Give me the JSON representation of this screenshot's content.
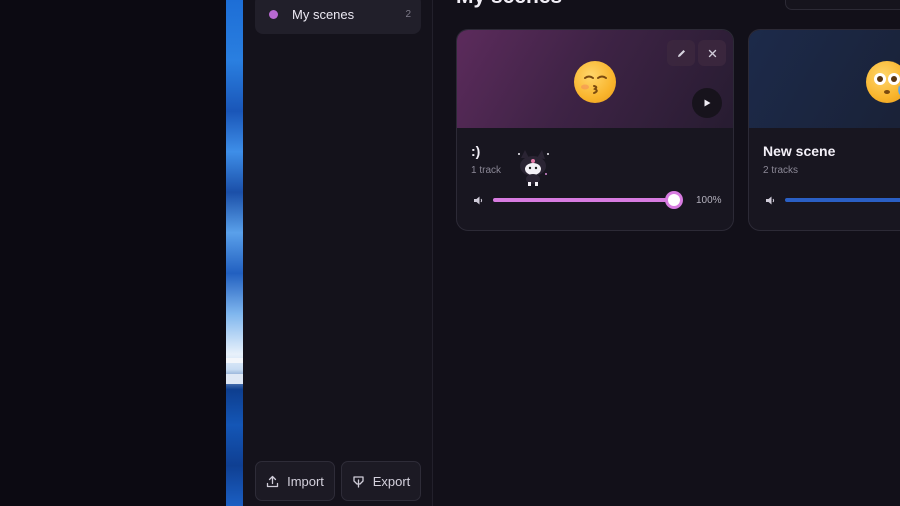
{
  "sidebar": {
    "nav_item": {
      "label": "My scenes",
      "count": "2",
      "dot_color": "#b869d2"
    },
    "import_label": "Import",
    "export_label": "Export"
  },
  "main": {
    "title": "My scenes",
    "scenes": [
      {
        "name": ":)",
        "tracks": "1 track",
        "volume_percent": 100,
        "volume_label": "100%",
        "accent_color": "#d77be0",
        "emoji": "kissing-face-icon"
      },
      {
        "name": "New scene",
        "tracks": "2 tracks",
        "accent_color": "#2a5fc4",
        "emoji": "flushed-face-icon"
      }
    ]
  },
  "colors": {
    "app_bg": "#121019",
    "sidebar_bg": "#14121b",
    "accent_purple": "#b869d2"
  }
}
